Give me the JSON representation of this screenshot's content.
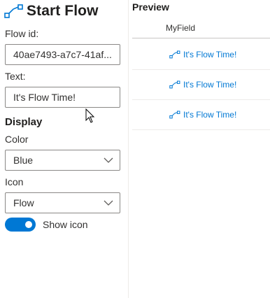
{
  "form": {
    "title": "Start Flow",
    "flow_id_label": "Flow id:",
    "flow_id_value": "40ae7493-a7c7-41af...",
    "text_label": "Text:",
    "text_value": "It's Flow Time!",
    "display_heading": "Display",
    "color_label": "Color",
    "color_value": "Blue",
    "icon_label": "Icon",
    "icon_value": "Flow",
    "show_icon_label": "Show icon",
    "show_icon_on": true
  },
  "preview": {
    "title": "Preview",
    "column_header": "MyField",
    "rows": [
      {
        "text": "It's Flow Time!",
        "icon": "flow-icon"
      },
      {
        "text": "It's Flow Time!",
        "icon": "flow-icon"
      },
      {
        "text": "It's Flow Time!",
        "icon": "flow-icon"
      }
    ]
  },
  "colors": {
    "accent": "#0078d4",
    "border": "#8a8886",
    "text": "#323130"
  }
}
